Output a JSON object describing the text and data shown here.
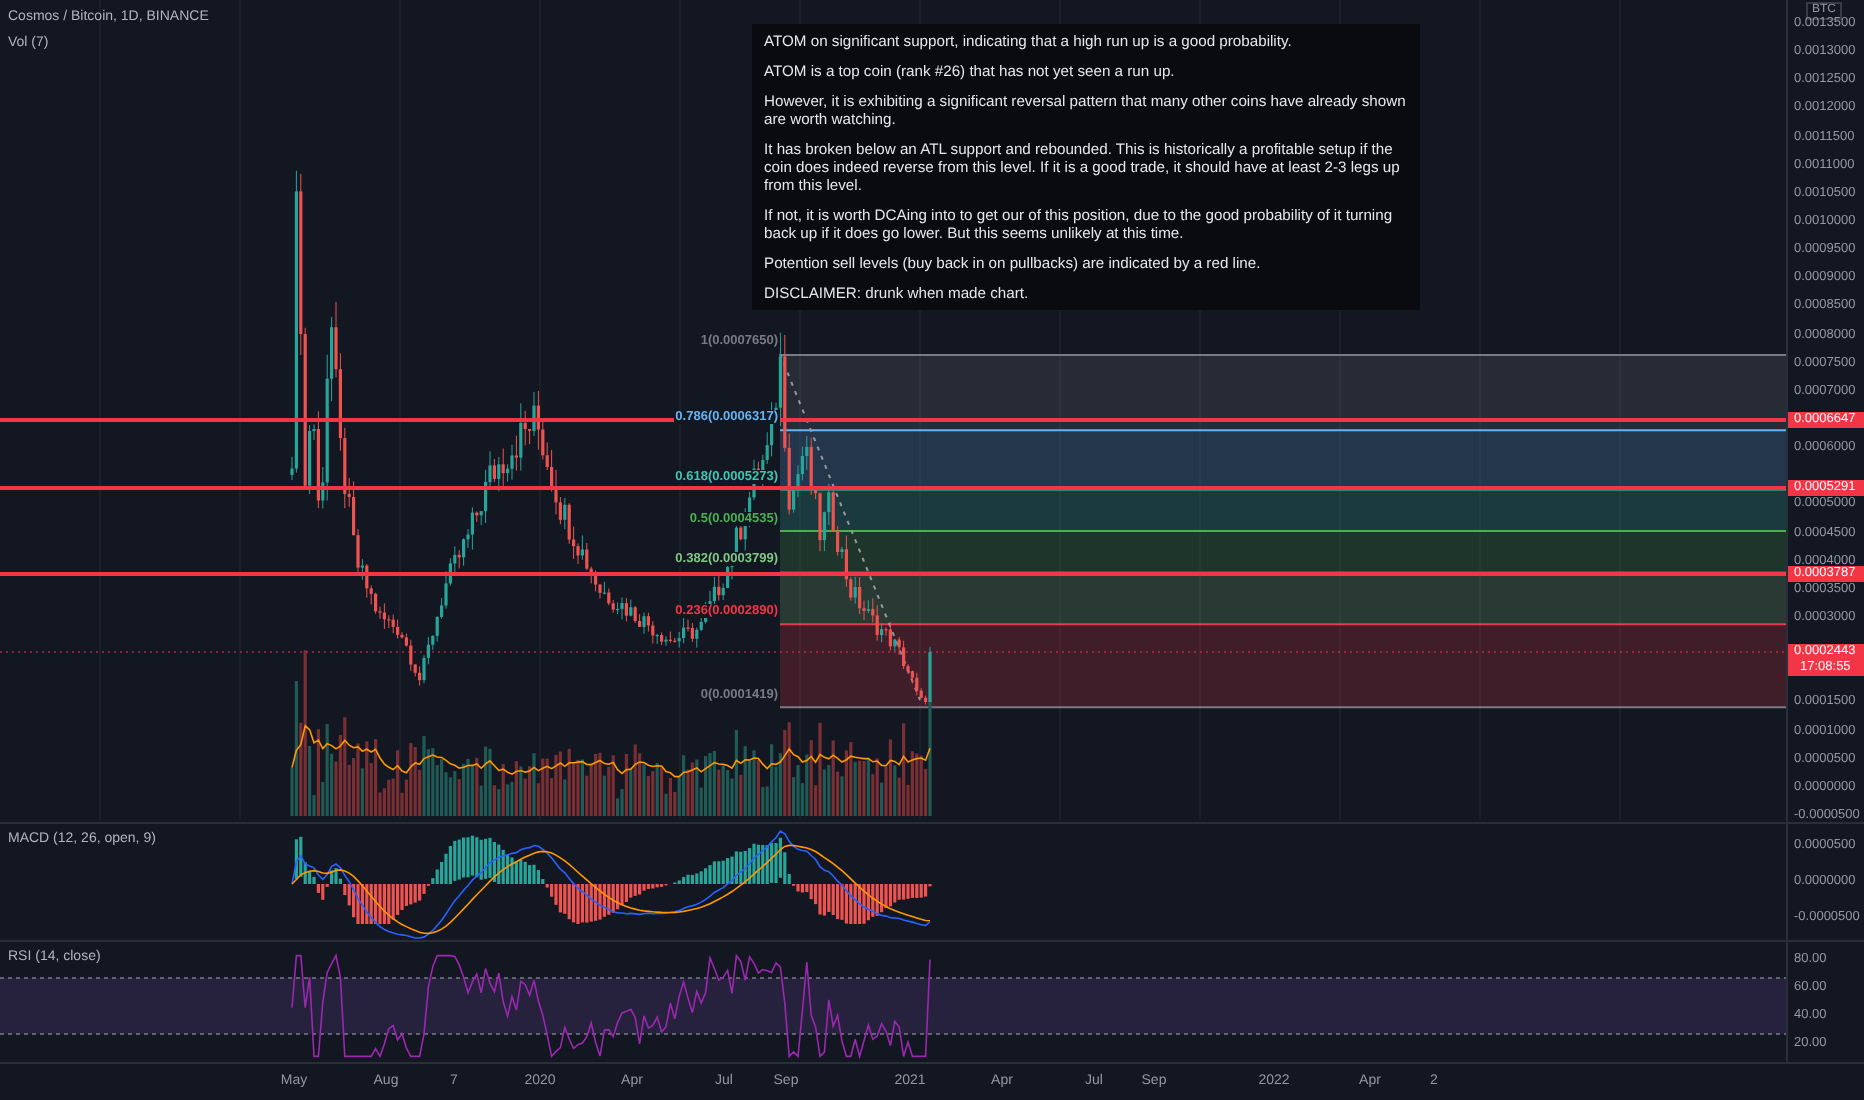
{
  "header": {
    "symbol": "Cosmos / Bitcoin, 1D, BINANCE",
    "volume_label": "Vol (7)"
  },
  "note": {
    "paragraphs": [
      "ATOM on significant support, indicating that a high run up is a good probability.",
      "ATOM is a top coin (rank #26) that has not yet seen a run up.",
      "However, it is exhibiting a significant reversal pattern that many other coins have already shown are worth watching.",
      "It has broken below an ATL support and rebounded. This is historically a profitable setup if the coin does indeed reverse from this level. If it is a good trade, it should have at least 2-3 legs up from this level.",
      "If not, it is worth DCAing into to get our of this position, due to the good probability of it turning back up if it does go lower. But this seems unlikely at this time.",
      "Potention sell levels (buy back in on pullbacks) are indicated by a red line.",
      "DISCLAIMER: drunk when made chart."
    ]
  },
  "fib_levels": [
    {
      "label": "1(0.0007650)",
      "color": "#787b86"
    },
    {
      "label": "0.786(0.0006317)",
      "color": "#64b5f6"
    },
    {
      "label": "0.618(0.0005273)",
      "color": "#3cc8b4"
    },
    {
      "label": "0.5(0.0004535)",
      "color": "#4caf50"
    },
    {
      "label": "0.382(0.0003799)",
      "color": "#81c784"
    },
    {
      "label": "0.236(0.0002890)",
      "color": "#f23645"
    },
    {
      "label": "0(0.0001419)",
      "color": "#787b86"
    }
  ],
  "sell_lines": [
    {
      "price_tag": "0.0006647"
    },
    {
      "price_tag": "0.0005291"
    },
    {
      "price_tag": "0.0003787"
    }
  ],
  "current_price": {
    "price_tag": "0.0002443",
    "countdown": "17:08:55"
  },
  "price_axis": {
    "unit": "BTC",
    "labels": [
      "0.0013500",
      "0.0013000",
      "0.0012500",
      "0.0012000",
      "0.0011500",
      "0.0011000",
      "0.0010500",
      "0.0010000",
      "0.0009500",
      "0.0009000",
      "0.0008500",
      "0.0008000",
      "0.0007500",
      "0.0007000",
      "0.0006000",
      "0.0005000",
      "0.0004500",
      "0.0004000",
      "0.0003500",
      "0.0003000",
      "0.0001500",
      "0.0001000",
      "0.0000500",
      "0.0000000",
      "-0.0000500"
    ]
  },
  "macd": {
    "title": "MACD (12, 26, open, 9)",
    "axis_labels": [
      "0.0000500",
      "0.0000000",
      "-0.0000500"
    ]
  },
  "rsi": {
    "title": "RSI (14, close)",
    "axis_labels": [
      "80.00",
      "60.00",
      "40.00",
      "20.00"
    ]
  },
  "time_axis": [
    "May",
    "Aug",
    "7",
    "2020",
    "Apr",
    "Jul",
    "Sep",
    "2021",
    "Apr",
    "Jul",
    "Sep",
    "2022",
    "Apr",
    "2"
  ]
}
